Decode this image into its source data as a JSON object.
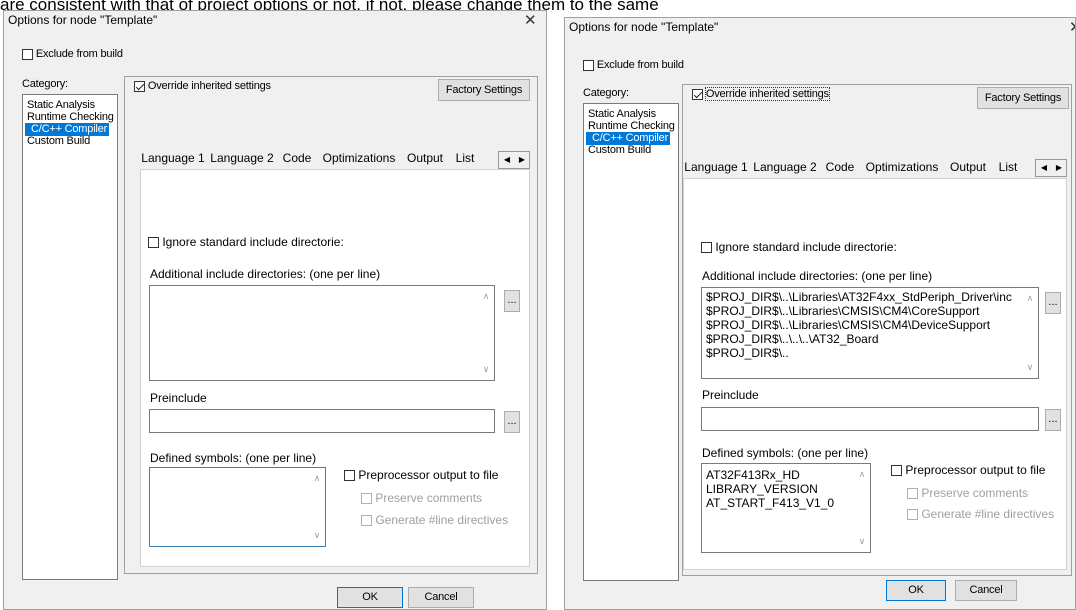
{
  "top_text": "are consistent with that of project options or not, if not, please change them to the same",
  "left": {
    "title": "Options for node \"Template\"",
    "close_label": "✕",
    "exclude_label": "Exclude from build",
    "category_label": "Category:",
    "categories": [
      "Static Analysis",
      "Runtime Checking",
      "C/C++ Compiler",
      "Custom Build"
    ],
    "override_label": "Override inherited settings",
    "factory_label": "Factory Settings",
    "tabs": [
      "Language 1",
      "Language 2",
      "Code",
      "Optimizations",
      "Output",
      "List"
    ],
    "ignore_label": "Ignore standard include directories",
    "ignore_visible": "Ignore standard include directorie:",
    "additional_label": "Additional include directories: (one per line)",
    "additional_lines": [],
    "preinclude_label": "Preinclude",
    "preinclude_value": "",
    "defined_label": "Defined symbols: (one per line)",
    "defined_lines": [],
    "preproc_label": "Preprocessor output to file",
    "preserve_label": "Preserve comments",
    "generate_label": "Generate #line directives",
    "dots_label": "...",
    "ok_label": "OK",
    "cancel_label": "Cancel"
  },
  "right": {
    "title": "Options for node \"Template\"",
    "close_label": "✕",
    "exclude_label": "Exclude from build",
    "category_label": "Category:",
    "categories": [
      "Static Analysis",
      "Runtime Checking",
      "C/C++ Compiler",
      "Custom Build"
    ],
    "override_label": "Override inherited settings",
    "factory_label": "Factory Settings",
    "tabs": [
      "Language 1",
      "Language 2",
      "Code",
      "Optimizations",
      "Output",
      "List"
    ],
    "ignore_visible": "Ignore standard include directorie:",
    "additional_label": "Additional include directories: (one per line)",
    "additional_lines": [
      "$PROJ_DIR$\\..\\Libraries\\AT32F4xx_StdPeriph_Driver\\inc",
      "$PROJ_DIR$\\..\\Libraries\\CMSIS\\CM4\\CoreSupport",
      "$PROJ_DIR$\\..\\Libraries\\CMSIS\\CM4\\DeviceSupport",
      "$PROJ_DIR$\\..\\..\\..\\AT32_Board",
      "$PROJ_DIR$\\.."
    ],
    "preinclude_label": "Preinclude",
    "preinclude_value": "",
    "defined_label": "Defined symbols: (one per line)",
    "defined_lines": [
      "AT32F413Rx_HD",
      "LIBRARY_VERSION",
      "AT_START_F413_V1_0"
    ],
    "preproc_label": "Preprocessor output to file",
    "preserve_label": "Preserve comments",
    "generate_label": "Generate #line directives",
    "dots_label": "...",
    "ok_label": "OK",
    "cancel_label": "Cancel"
  },
  "colors": {
    "selection": "#0078d7",
    "dialog_bg": "#f0f0f0"
  }
}
